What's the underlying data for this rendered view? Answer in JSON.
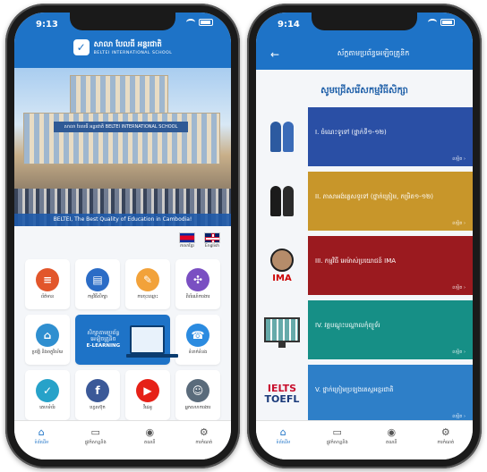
{
  "left_screen": {
    "status": {
      "time": "9:13"
    },
    "header": {
      "school_name_kh": "សាលា បែលធី អន្តរជាតិ",
      "school_name_en": "BELTEI INTERNATIONAL SCHOOL"
    },
    "hero": {
      "caption": "BELTEI, The Best Quality of Education in Cambodia!",
      "sign_text": "សាលា បែលធី អន្តរជាតិ  BELTEI INTERNATIONAL SCHOOL"
    },
    "languages": [
      {
        "label": "ភាសាខ្មែរ"
      },
      {
        "label": "English"
      }
    ],
    "tiles": [
      {
        "label": "ព័ត៌មាន",
        "icon": "news-icon",
        "color": "#e2562b",
        "glyph": "≡"
      },
      {
        "label": "កម្មវិធីសិក្សា",
        "icon": "books-icon",
        "color": "#2b6cc6",
        "glyph": "▤"
      },
      {
        "label": "ការចុះឈ្មោះ",
        "icon": "register-icon",
        "color": "#f2a23a",
        "glyph": "✎"
      },
      {
        "label": "ពិព័រណ៍ការងារ",
        "icon": "network-icon",
        "color": "#7a4fc2",
        "glyph": "✣"
      },
      {
        "label": "ប្រវត្តិ និងចក្ខុវិស័យ",
        "icon": "building-icon",
        "color": "#2f8fd0",
        "glyph": "⌂"
      },
      {
        "label": "ទំនាក់ទំនង",
        "icon": "phone-icon",
        "color": "#2b8be0",
        "glyph": "☎"
      },
      {
        "label": "គេហទំព័រ",
        "icon": "web-icon",
        "color": "#27a2c9",
        "glyph": "✓"
      },
      {
        "label": "ហ្វេសប៊ុក",
        "icon": "facebook-icon",
        "color": "#3b5998",
        "glyph": "f"
      },
      {
        "label": "វីដេអូ",
        "icon": "youtube-icon",
        "color": "#e62117",
        "glyph": "▶"
      },
      {
        "label": "អ្នកសហការងារ",
        "icon": "people-icon",
        "color": "#5a6b7b",
        "glyph": "☺"
      }
    ],
    "elearning": {
      "kh": "សិក្សាតាមប្រព័ន្ធ អេឡិចត្រូនិច",
      "en": "E-LEARNING"
    },
    "tabs": [
      {
        "label": "ទំព័រដើម",
        "icon": "home-icon",
        "glyph": "⌂",
        "active": true
      },
      {
        "label": "ផ្លូវកំសាន្តនិង",
        "icon": "tv-icon",
        "glyph": "▭",
        "active": false
      },
      {
        "label": "គណនី",
        "icon": "account-icon",
        "glyph": "◉",
        "active": false
      },
      {
        "label": "ការកំណត់",
        "icon": "settings-icon",
        "glyph": "⚙",
        "active": false
      }
    ]
  },
  "right_screen": {
    "status": {
      "time": "9:14"
    },
    "header": {
      "title": "ស័ក្ដតាមប្រព័ន្ធអេឡិចត្រូនិក"
    },
    "subtitle": "សូមជ្រើសរើសកម្មវិធីសិក្សា",
    "more_label": "លម្អិត ›",
    "cards": [
      {
        "title": "I. ចំណេះទូទៅ (ថ្នាក់ទី១-១២)",
        "color": "#2a4fa5",
        "image": "graduates-image"
      },
      {
        "title": "II. ភាសាអង់គ្លេសទូទៅ (ថ្នាក់ត្រៀម, កម្រិត១-១២)",
        "color": "#c8962a",
        "image": "graduates-couple-image"
      },
      {
        "title": "III. កម្មវិធី អេម៉ាស់ប្រយោជន៍ IMA",
        "color": "#9b1a1f",
        "image": "ima-logo-image"
      },
      {
        "title": "IV. វគ្គបណ្ដុះបណ្ដាលកុំព្យូទ័រ",
        "color": "#168f86",
        "image": "computer-image"
      },
      {
        "title": "V. ថ្នាក់ត្រៀមប្រឡងតេស្តអន្តរជាតិ",
        "color": "#2e7fc8",
        "image": "ielts-toefl-image",
        "brand1": "IELTS",
        "brand2": "TOEFL"
      }
    ],
    "tabs": [
      {
        "label": "ទំព័រដើម",
        "icon": "home-icon",
        "glyph": "⌂",
        "active": true
      },
      {
        "label": "ផ្លូវកំសាន្តនិង",
        "icon": "tv-icon",
        "glyph": "▭",
        "active": false
      },
      {
        "label": "គណនី",
        "icon": "account-icon",
        "glyph": "◉",
        "active": false
      },
      {
        "label": "ការកំណត់",
        "icon": "settings-icon",
        "glyph": "⚙",
        "active": false
      }
    ]
  }
}
